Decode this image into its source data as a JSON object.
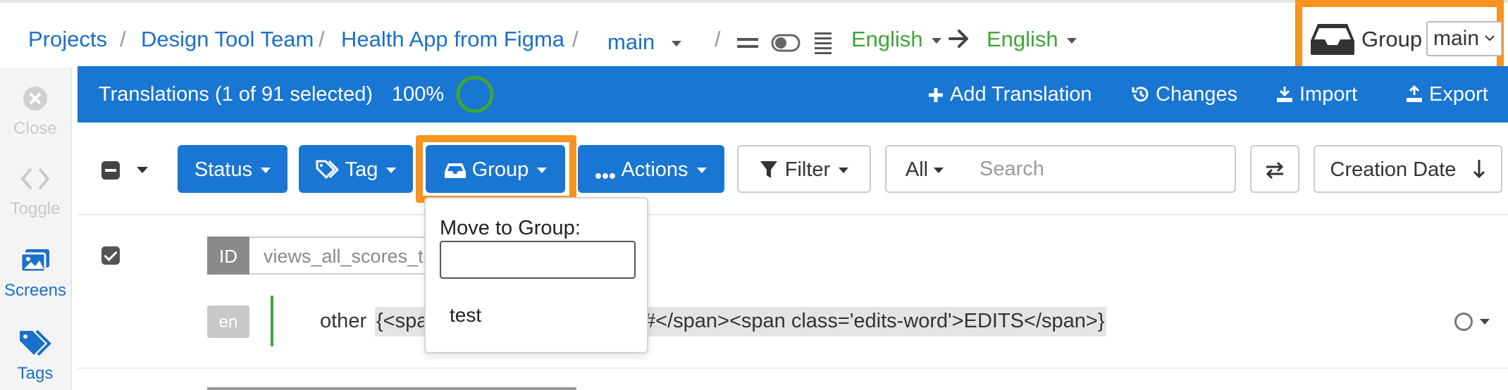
{
  "breadcrumb": {
    "projects": "Projects",
    "team": "Design Tool Team",
    "project": "Health App from Figma",
    "branch": "main",
    "separator": "/",
    "source_language": "English",
    "target_language": "English"
  },
  "group_switch": {
    "label": "Group",
    "selected": "main"
  },
  "rail": [
    {
      "label": "Close",
      "icon": "close-icon",
      "disabled": true
    },
    {
      "label": "Toggle",
      "icon": "code-toggle-icon",
      "disabled": true
    },
    {
      "label": "Screens",
      "icon": "images-icon",
      "disabled": false
    },
    {
      "label": "Tags",
      "icon": "tags-icon",
      "disabled": false
    }
  ],
  "header": {
    "title": "Translations (1 of 91 selected)",
    "progress_label": "100%",
    "progress": 100,
    "add_translation": "Add Translation",
    "changes": "Changes",
    "import": "Import",
    "export": "Export"
  },
  "toolbar": {
    "status": "Status",
    "tag": "Tag",
    "group": "Group",
    "actions": "Actions",
    "filter": "Filter",
    "scope": "All",
    "search_placeholder": "Search",
    "sort": "Creation Date"
  },
  "group_dropdown": {
    "title": "Move to Group:",
    "input_value": "",
    "items": [
      "test"
    ]
  },
  "translation": {
    "id_label": "ID",
    "id_value": "views_all_scores_te",
    "lang": "en",
    "plural_form": "other",
    "text_start": "{<spa",
    "text_end": "#</span><span class='edits-word'>EDITS</span>}"
  },
  "colors": {
    "primary": "#1976d2",
    "highlight": "#f7931e",
    "link": "#1a6fc9",
    "language": "#3fa535"
  }
}
